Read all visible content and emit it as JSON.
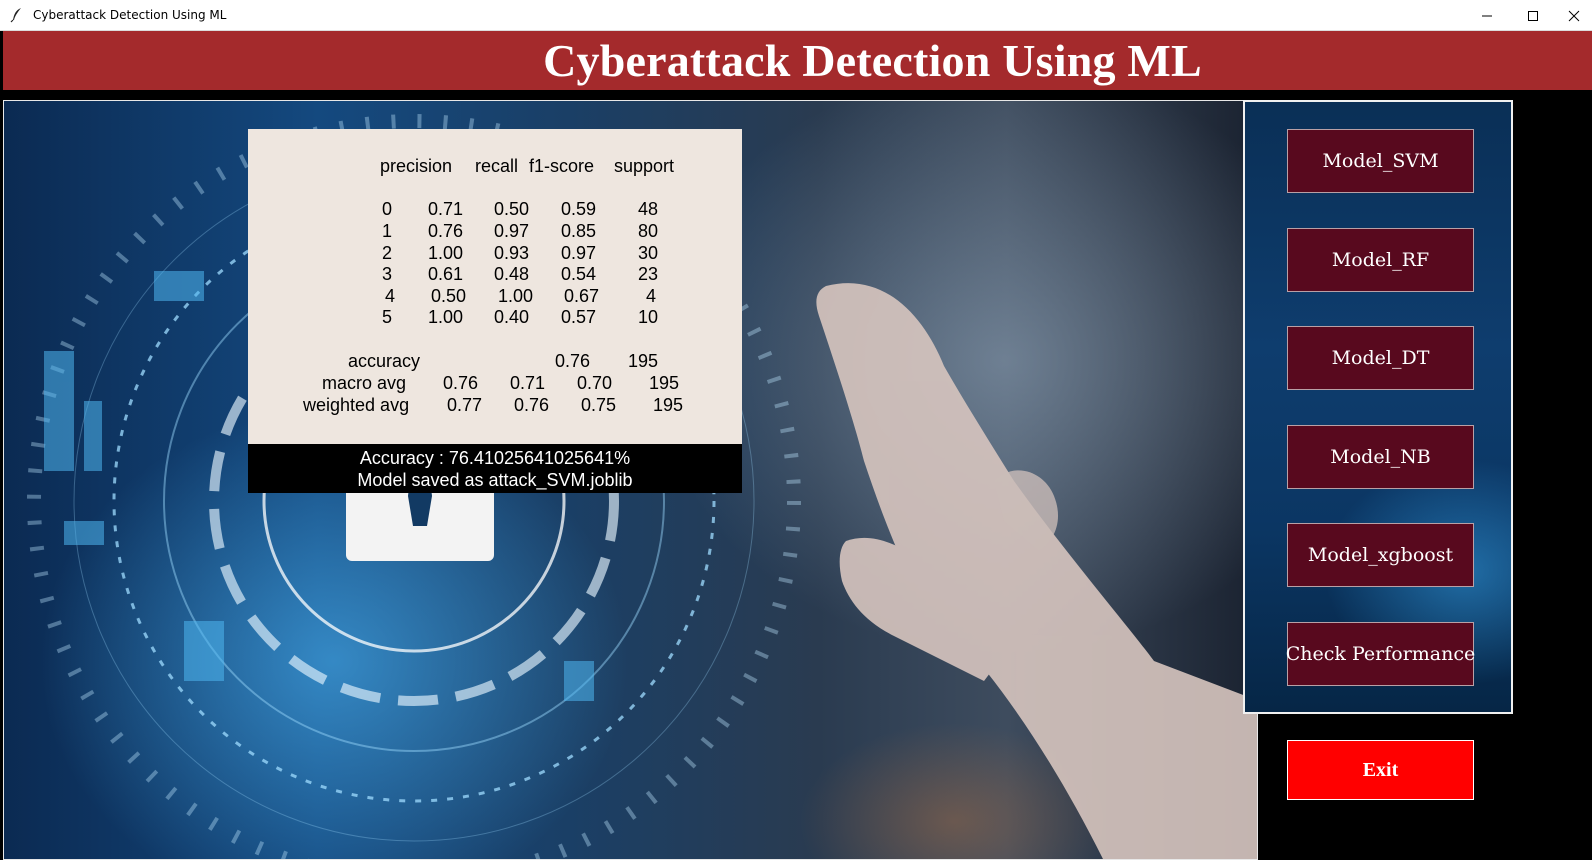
{
  "window": {
    "title": "Cyberattack Detection Using ML",
    "controls": {
      "minimize": "—",
      "maximize": "☐",
      "close": "✕"
    }
  },
  "header": {
    "title": "Cyberattack Detection Using ML"
  },
  "report": {
    "headers": [
      "precision",
      "recall",
      "f1-score",
      "support"
    ],
    "rows": [
      {
        "label": "0",
        "precision": "0.71",
        "recall": "0.50",
        "f1": "0.59",
        "support": "48"
      },
      {
        "label": "1",
        "precision": "0.76",
        "recall": "0.97",
        "f1": "0.85",
        "support": "80"
      },
      {
        "label": "2",
        "precision": "1.00",
        "recall": "0.93",
        "f1": "0.97",
        "support": "30"
      },
      {
        "label": "3",
        "precision": "0.61",
        "recall": "0.48",
        "f1": "0.54",
        "support": "23"
      },
      {
        "label": "4",
        "precision": "0.50",
        "recall": "1.00",
        "f1": "0.67",
        "support": "4"
      },
      {
        "label": "5",
        "precision": "1.00",
        "recall": "0.40",
        "f1": "0.57",
        "support": "10"
      }
    ],
    "accuracy": {
      "label": "accuracy",
      "f1": "0.76",
      "support": "195"
    },
    "macro": {
      "label": "macro avg",
      "precision": "0.76",
      "recall": "0.71",
      "f1": "0.70",
      "support": "195"
    },
    "weighted": {
      "label": "weighted avg",
      "precision": "0.77",
      "recall": "0.76",
      "f1": "0.75",
      "support": "195"
    },
    "accuracy_line": "Accuracy : 76.41025641025641%",
    "saved_line": "Model saved as attack_SVM.joblib"
  },
  "panel": {
    "buttons": [
      "Model_SVM",
      "Model_RF",
      "Model_DT",
      "Model_NB",
      "Model_xgboost",
      "Check Performance"
    ],
    "exit_label": "Exit"
  },
  "colors": {
    "header_bg": "#a42a2c",
    "button_bg": "#58091e",
    "exit_bg": "#ff0000",
    "report_bg": "#eee6df"
  }
}
